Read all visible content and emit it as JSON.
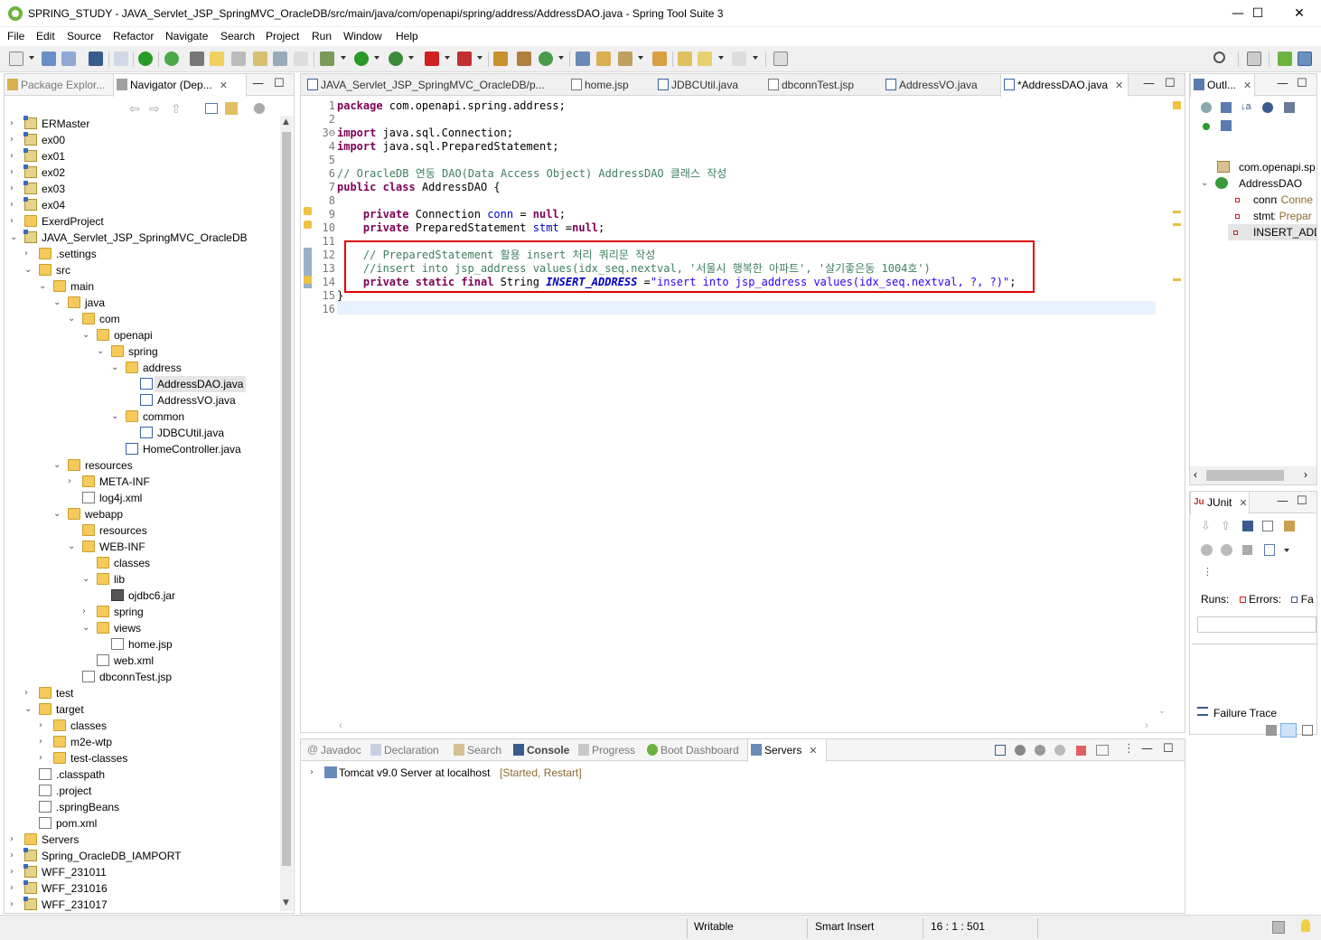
{
  "window": {
    "title": "SPRING_STUDY - JAVA_Servlet_JSP_SpringMVC_OracleDB/src/main/java/com/openapi/spring/address/AddressDAO.java - Spring Tool Suite 3",
    "minimize": "—",
    "maximize": "☐",
    "close": "✕"
  },
  "menu": [
    "File",
    "Edit",
    "Source",
    "Refactor",
    "Navigate",
    "Search",
    "Project",
    "Run",
    "Window",
    "Help"
  ],
  "left_panel": {
    "tabs": [
      {
        "label": "Package Explor..."
      },
      {
        "label": "Navigator (Dep..."
      }
    ],
    "tree": [
      {
        "label": "ERMaster",
        "depth": 0,
        "toggle": "›",
        "icon": "proj"
      },
      {
        "label": "ex00",
        "depth": 0,
        "toggle": "›",
        "icon": "proj"
      },
      {
        "label": "ex01",
        "depth": 0,
        "toggle": "›",
        "icon": "proj"
      },
      {
        "label": "ex02",
        "depth": 0,
        "toggle": "›",
        "icon": "proj"
      },
      {
        "label": "ex03",
        "depth": 0,
        "toggle": "›",
        "icon": "proj"
      },
      {
        "label": "ex04",
        "depth": 0,
        "toggle": "›",
        "icon": "proj"
      },
      {
        "label": "ExerdProject",
        "depth": 0,
        "toggle": "›",
        "icon": "folder"
      },
      {
        "label": "JAVA_Servlet_JSP_SpringMVC_OracleDB",
        "depth": 0,
        "toggle": "⌄",
        "icon": "proj"
      },
      {
        "label": ".settings",
        "depth": 1,
        "toggle": "›",
        "icon": "folder"
      },
      {
        "label": "src",
        "depth": 1,
        "toggle": "⌄",
        "icon": "folder"
      },
      {
        "label": "main",
        "depth": 2,
        "toggle": "⌄",
        "icon": "folder"
      },
      {
        "label": "java",
        "depth": 3,
        "toggle": "⌄",
        "icon": "folder"
      },
      {
        "label": "com",
        "depth": 4,
        "toggle": "⌄",
        "icon": "folder"
      },
      {
        "label": "openapi",
        "depth": 5,
        "toggle": "⌄",
        "icon": "folder"
      },
      {
        "label": "spring",
        "depth": 6,
        "toggle": "⌄",
        "icon": "folder"
      },
      {
        "label": "address",
        "depth": 7,
        "toggle": "⌄",
        "icon": "folder"
      },
      {
        "label": "AddressDAO.java",
        "depth": 8,
        "toggle": "",
        "icon": "jfile",
        "selected": true
      },
      {
        "label": "AddressVO.java",
        "depth": 8,
        "toggle": "",
        "icon": "jfile"
      },
      {
        "label": "common",
        "depth": 7,
        "toggle": "⌄",
        "icon": "folder"
      },
      {
        "label": "JDBCUtil.java",
        "depth": 8,
        "toggle": "",
        "icon": "jfile"
      },
      {
        "label": "HomeController.java",
        "depth": 7,
        "toggle": "",
        "icon": "jfile"
      },
      {
        "label": "resources",
        "depth": 3,
        "toggle": "⌄",
        "icon": "folder"
      },
      {
        "label": "META-INF",
        "depth": 4,
        "toggle": "›",
        "icon": "folder"
      },
      {
        "label": "log4j.xml",
        "depth": 4,
        "toggle": "",
        "icon": "file"
      },
      {
        "label": "webapp",
        "depth": 3,
        "toggle": "⌄",
        "icon": "folder"
      },
      {
        "label": "resources",
        "depth": 4,
        "toggle": "",
        "icon": "folder"
      },
      {
        "label": "WEB-INF",
        "depth": 4,
        "toggle": "⌄",
        "icon": "folder"
      },
      {
        "label": "classes",
        "depth": 5,
        "toggle": "",
        "icon": "folder"
      },
      {
        "label": "lib",
        "depth": 5,
        "toggle": "⌄",
        "icon": "folder"
      },
      {
        "label": "ojdbc6.jar",
        "depth": 6,
        "toggle": "",
        "icon": "jar"
      },
      {
        "label": "spring",
        "depth": 5,
        "toggle": "›",
        "icon": "folder"
      },
      {
        "label": "views",
        "depth": 5,
        "toggle": "⌄",
        "icon": "folder"
      },
      {
        "label": "home.jsp",
        "depth": 6,
        "toggle": "",
        "icon": "file"
      },
      {
        "label": "web.xml",
        "depth": 5,
        "toggle": "",
        "icon": "file"
      },
      {
        "label": "dbconnTest.jsp",
        "depth": 4,
        "toggle": "",
        "icon": "file"
      },
      {
        "label": "test",
        "depth": 1,
        "toggle": "›",
        "icon": "folder"
      },
      {
        "label": "target",
        "depth": 0,
        "toggle": "⌄",
        "icon": "folder",
        "indent_override": 1
      },
      {
        "label": "classes",
        "depth": 1,
        "toggle": "›",
        "icon": "folder",
        "indent_override": 2
      },
      {
        "label": "m2e-wtp",
        "depth": 1,
        "toggle": "›",
        "icon": "folder",
        "indent_override": 2
      },
      {
        "label": "test-classes",
        "depth": 1,
        "toggle": "›",
        "icon": "folder",
        "indent_override": 2
      },
      {
        "label": ".classpath",
        "depth": 1,
        "toggle": "",
        "icon": "file"
      },
      {
        "label": ".project",
        "depth": 1,
        "toggle": "",
        "icon": "file"
      },
      {
        "label": ".springBeans",
        "depth": 1,
        "toggle": "",
        "icon": "file"
      },
      {
        "label": "pom.xml",
        "depth": 1,
        "toggle": "",
        "icon": "file"
      },
      {
        "label": "Servers",
        "depth": 0,
        "toggle": "›",
        "icon": "folder"
      },
      {
        "label": "Spring_OracleDB_IAMPORT",
        "depth": 0,
        "toggle": "›",
        "icon": "proj"
      },
      {
        "label": "WFF_231011",
        "depth": 0,
        "toggle": "›",
        "icon": "proj"
      },
      {
        "label": "WFF_231016",
        "depth": 0,
        "toggle": "›",
        "icon": "proj"
      },
      {
        "label": "WFF_231017",
        "depth": 0,
        "toggle": "›",
        "icon": "proj"
      }
    ]
  },
  "editor": {
    "tabs": [
      {
        "label": "JAVA_Servlet_JSP_SpringMVC_OracleDB/p..."
      },
      {
        "label": "home.jsp"
      },
      {
        "label": "JDBCUtil.java"
      },
      {
        "label": "dbconnTest.jsp"
      },
      {
        "label": "AddressVO.java"
      },
      {
        "label": "*AddressDAO.java",
        "active": true
      }
    ],
    "line_numbers": [
      "1",
      "2",
      "3⊖",
      "4",
      "5",
      "6",
      "7",
      "8",
      "9",
      "10",
      "11",
      "12",
      "13",
      "14",
      "15",
      "16"
    ],
    "lines": [
      [
        {
          "t": "kw",
          "v": "package"
        },
        {
          "t": "p",
          "v": " com.openapi.spring.address;"
        }
      ],
      [],
      [
        {
          "t": "kw",
          "v": "import"
        },
        {
          "t": "p",
          "v": " java.sql.Connection;"
        }
      ],
      [
        {
          "t": "kw",
          "v": "import"
        },
        {
          "t": "p",
          "v": " java.sql.PreparedStatement;"
        }
      ],
      [],
      [
        {
          "t": "cm",
          "v": "// OracleDB 연동 DAO(Data Access Object) AddressDAO 클래스 작성"
        }
      ],
      [
        {
          "t": "kw",
          "v": "public"
        },
        {
          "t": "p",
          "v": " "
        },
        {
          "t": "kw",
          "v": "class"
        },
        {
          "t": "p",
          "v": " AddressDAO {"
        }
      ],
      [],
      [
        {
          "t": "p",
          "v": "    "
        },
        {
          "t": "kw",
          "v": "private"
        },
        {
          "t": "p",
          "v": " Connection "
        },
        {
          "t": "fld",
          "v": "conn"
        },
        {
          "t": "p",
          "v": " = "
        },
        {
          "t": "kw",
          "v": "null"
        },
        {
          "t": "p",
          "v": ";"
        }
      ],
      [
        {
          "t": "p",
          "v": "    "
        },
        {
          "t": "kw",
          "v": "private"
        },
        {
          "t": "p",
          "v": " PreparedStatement "
        },
        {
          "t": "fld",
          "v": "stmt"
        },
        {
          "t": "p",
          "v": " ="
        },
        {
          "t": "kw",
          "v": "null"
        },
        {
          "t": "p",
          "v": ";"
        }
      ],
      [],
      [
        {
          "t": "p",
          "v": "    "
        },
        {
          "t": "cm",
          "v": "// PreparedStatement 활용 insert 처리 쿼리문 작성"
        }
      ],
      [
        {
          "t": "p",
          "v": "    "
        },
        {
          "t": "cm",
          "v": "//insert into jsp_address values(idx_seq.nextval, '서울시 행복한 아파트', '살기좋은동 1004호')"
        }
      ],
      [
        {
          "t": "p",
          "v": "    "
        },
        {
          "t": "kw",
          "v": "private"
        },
        {
          "t": "p",
          "v": " "
        },
        {
          "t": "kw",
          "v": "static"
        },
        {
          "t": "p",
          "v": " "
        },
        {
          "t": "kw",
          "v": "final"
        },
        {
          "t": "p",
          "v": " String "
        },
        {
          "t": "sfld",
          "v": "INSERT_ADDRESS"
        },
        {
          "t": "p",
          "v": " ="
        },
        {
          "t": "str",
          "v": "\"insert into jsp_address values(idx_seq.nextval, ?, ?)\""
        },
        {
          "t": "p",
          "v": ";"
        }
      ],
      [
        {
          "t": "p",
          "v": "}"
        }
      ],
      []
    ]
  },
  "outline": {
    "tab": "Outl...",
    "items": [
      {
        "label": "com.openapi.sp",
        "kind": "package"
      },
      {
        "label": "AddressDAO",
        "kind": "class"
      },
      {
        "label": "conn",
        "type": " : Conne",
        "kind": "field"
      },
      {
        "label": "stmt",
        "type": " : Prepar",
        "kind": "field"
      },
      {
        "label": "INSERT_ADD",
        "type": "",
        "kind": "static-field"
      }
    ]
  },
  "junit": {
    "tab": "JUnit",
    "runs": "Runs:",
    "errors": "Errors:",
    "failures": "Fa",
    "failure_trace": "Failure Trace"
  },
  "bottom_panel": {
    "tabs": [
      {
        "label": "Javadoc"
      },
      {
        "label": "Declaration"
      },
      {
        "label": "Search"
      },
      {
        "label": "Console"
      },
      {
        "label": "Progress"
      },
      {
        "label": "Boot Dashboard"
      },
      {
        "label": "Servers",
        "active": true
      }
    ],
    "server": {
      "name": "Tomcat v9.0 Server at localhost",
      "state": "[Started, Restart]"
    }
  },
  "status": {
    "writable": "Writable",
    "insert_mode": "Smart Insert",
    "position": "16 : 1 : 501"
  },
  "colors": {
    "keyword": "#7f0055",
    "comment": "#3f7f5f",
    "string": "#2a00ff",
    "field": "#0000c0",
    "highlight_box": "#e00000"
  }
}
